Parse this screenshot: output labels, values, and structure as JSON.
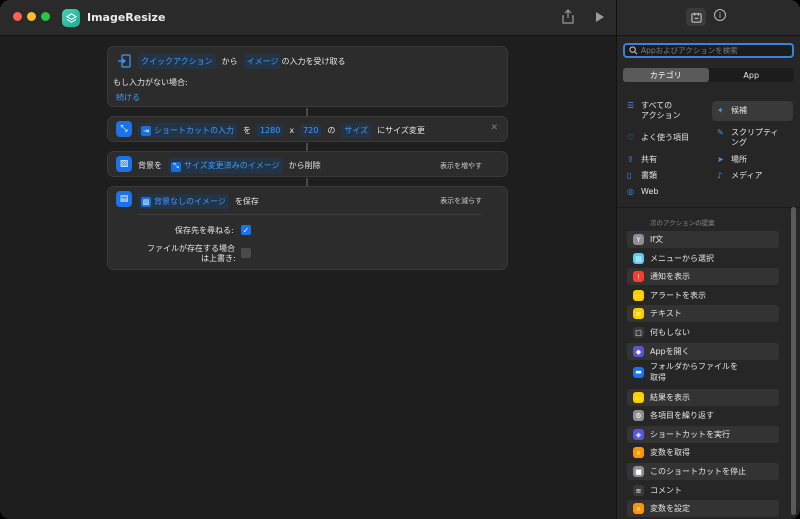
{
  "app_title": "ImageResize",
  "colors": {
    "accent": "#3d9cff",
    "red": "#ff5f57",
    "yellow": "#febc2e",
    "green": "#28c840"
  },
  "action1": {
    "tok1": "クイックアクション",
    "t1": "から",
    "tok2": "イメージ",
    "t2": "の入力を受け取る",
    "no_input": "もし入力がない場合:",
    "continue": "続ける"
  },
  "action2": {
    "tok1": "ショートカットの入力",
    "t1": "を",
    "w": "1280",
    "x": "x",
    "h": "720",
    "t2": "の",
    "tok2": "サイズ",
    "t3": "にサイズ変更"
  },
  "action3": {
    "t1": "背景を",
    "tok1": "サイズ変更済みのイメージ",
    "t2": "から削除",
    "more": "表示を増やす"
  },
  "action4": {
    "tok1": "背景なしのイメージ",
    "t1": "を保存",
    "less": "表示を減らす",
    "ask_label": "保存先を尋ねる:",
    "overwrite_label": "ファイルが存在する場合",
    "overwrite_label2": "は上書き:"
  },
  "sidebar": {
    "search_placeholder": "Appおよびアクションを検索",
    "seg_categories": "カテゴリ",
    "seg_app": "App",
    "categories": {
      "all_1": "すべての",
      "all_2": "アクション",
      "suggest": "候補",
      "fav": "よく使う項目",
      "script_1": "スクリプティ",
      "script_2": "ング",
      "share": "共有",
      "location": "場所",
      "docs": "書類",
      "media": "メディア",
      "web": "Web"
    },
    "suggestions_header": "次のアクションの提案",
    "items": [
      {
        "label": "If文",
        "icon": "Y",
        "color": "#8e8e93"
      },
      {
        "label": "メニューから選択",
        "icon": "▤",
        "color": "#5ac8fa"
      },
      {
        "label": "通知を表示",
        "icon": "!",
        "color": "#ff3b30"
      },
      {
        "label": "アラートを表示",
        "icon": "▭",
        "color": "#ffcc00"
      },
      {
        "label": "テキスト",
        "icon": "≡",
        "color": "#ffcc00"
      },
      {
        "label": "何もしない",
        "icon": "□",
        "color": "#3a3a3a"
      },
      {
        "label": "Appを開く",
        "icon": "◆",
        "color": "#5856d6"
      },
      {
        "label": "フォルダからファイルを",
        "label2": "取得",
        "icon": "▬",
        "color": "#1a73e8"
      },
      {
        "label": "結果を表示",
        "icon": "▭",
        "color": "#ffcc00"
      },
      {
        "label": "各項目を繰り返す",
        "icon": "⚙",
        "color": "#8e8e93"
      },
      {
        "label": "ショートカットを実行",
        "icon": "◈",
        "color": "#5856d6"
      },
      {
        "label": "変数を取得",
        "icon": "x",
        "color": "#ff9500"
      },
      {
        "label": "このショートカットを停止",
        "icon": "■",
        "color": "#8e8e93"
      },
      {
        "label": "コメント",
        "icon": "≡",
        "color": "#3a3a3a"
      },
      {
        "label": "変数を設定",
        "icon": "x",
        "color": "#ff9500"
      }
    ]
  }
}
